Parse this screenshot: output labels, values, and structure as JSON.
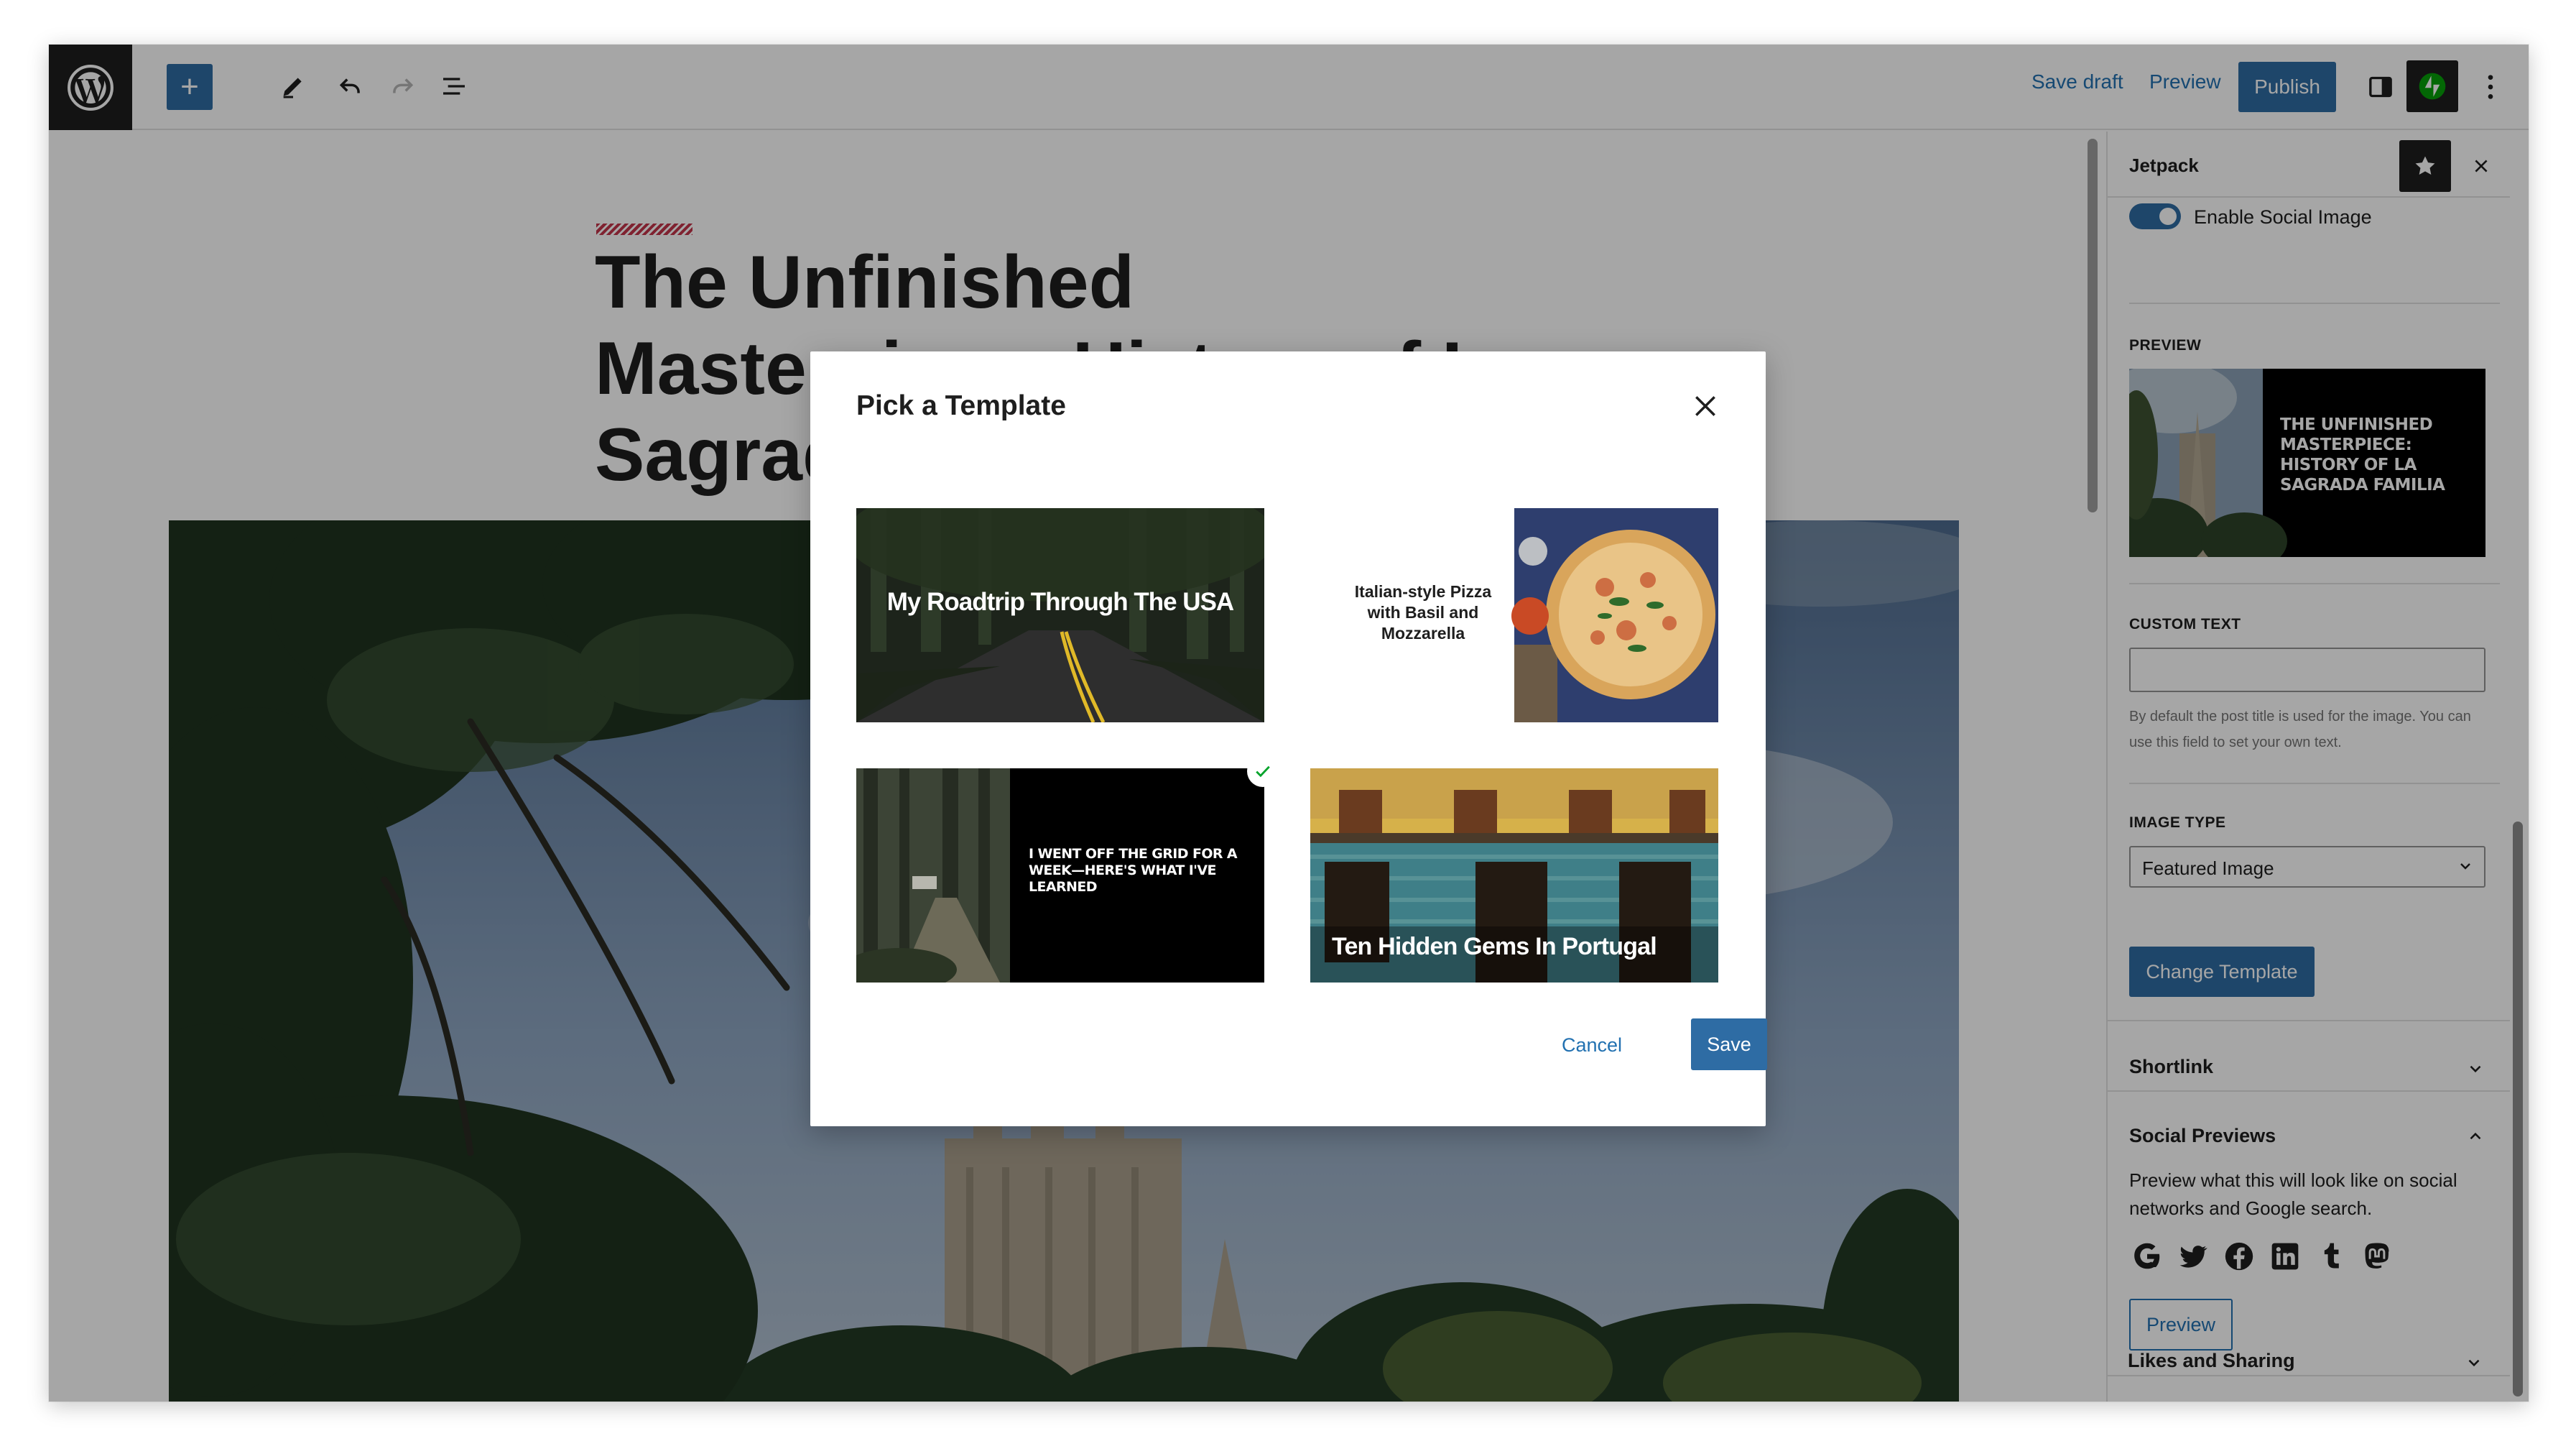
{
  "toolbar": {
    "save_draft": "Save draft",
    "preview": "Preview",
    "publish": "Publish",
    "add_block_symbol": "+"
  },
  "editor": {
    "post_title": "The Unfinished Masterpiece: History of La Sagrada Familia"
  },
  "sidebar": {
    "title": "Jetpack",
    "toggle_label": "Enable Social Image",
    "toggle_on": true,
    "preview_caption": "PREVIEW",
    "preview_image_text": "THE UNFINISHED MASTERPIECE: HISTORY OF LA SAGRADA FAMILIA",
    "custom_text_caption": "CUSTOM TEXT",
    "custom_text_value": "",
    "custom_text_help": "By default the post title is used for the image. You can use this field to set your own text.",
    "image_type_caption": "IMAGE TYPE",
    "image_type_value": "Featured Image",
    "change_template": "Change Template",
    "panels": {
      "shortlink": "Shortlink",
      "social_previews": "Social Previews",
      "likes_sharing": "Likes and Sharing"
    },
    "social_previews_desc": "Preview what this will look like on social networks and Google search.",
    "social_icons": [
      "google-icon",
      "twitter-icon",
      "facebook-icon",
      "linkedin-icon",
      "tumblr-icon",
      "mastodon-icon"
    ],
    "social_preview_button": "Preview"
  },
  "modal": {
    "title": "Pick a Template",
    "templates": [
      {
        "text": "My Roadtrip Through The USA",
        "selected": false
      },
      {
        "text": "Italian-style Pizza with Basil and Mozzarella",
        "selected": false
      },
      {
        "text": "I WENT OFF THE GRID FOR A WEEK—HERE'S WHAT I'VE LEARNED",
        "selected": true
      },
      {
        "text": "Ten Hidden Gems In Portugal",
        "selected": false
      }
    ],
    "cancel": "Cancel",
    "save": "Save"
  },
  "colors": {
    "accent": "#2e6ca4",
    "link": "#2271b1",
    "dark": "#1e1e1e",
    "jetpack_green": "#069e08",
    "selected_check": "#00a32a"
  }
}
